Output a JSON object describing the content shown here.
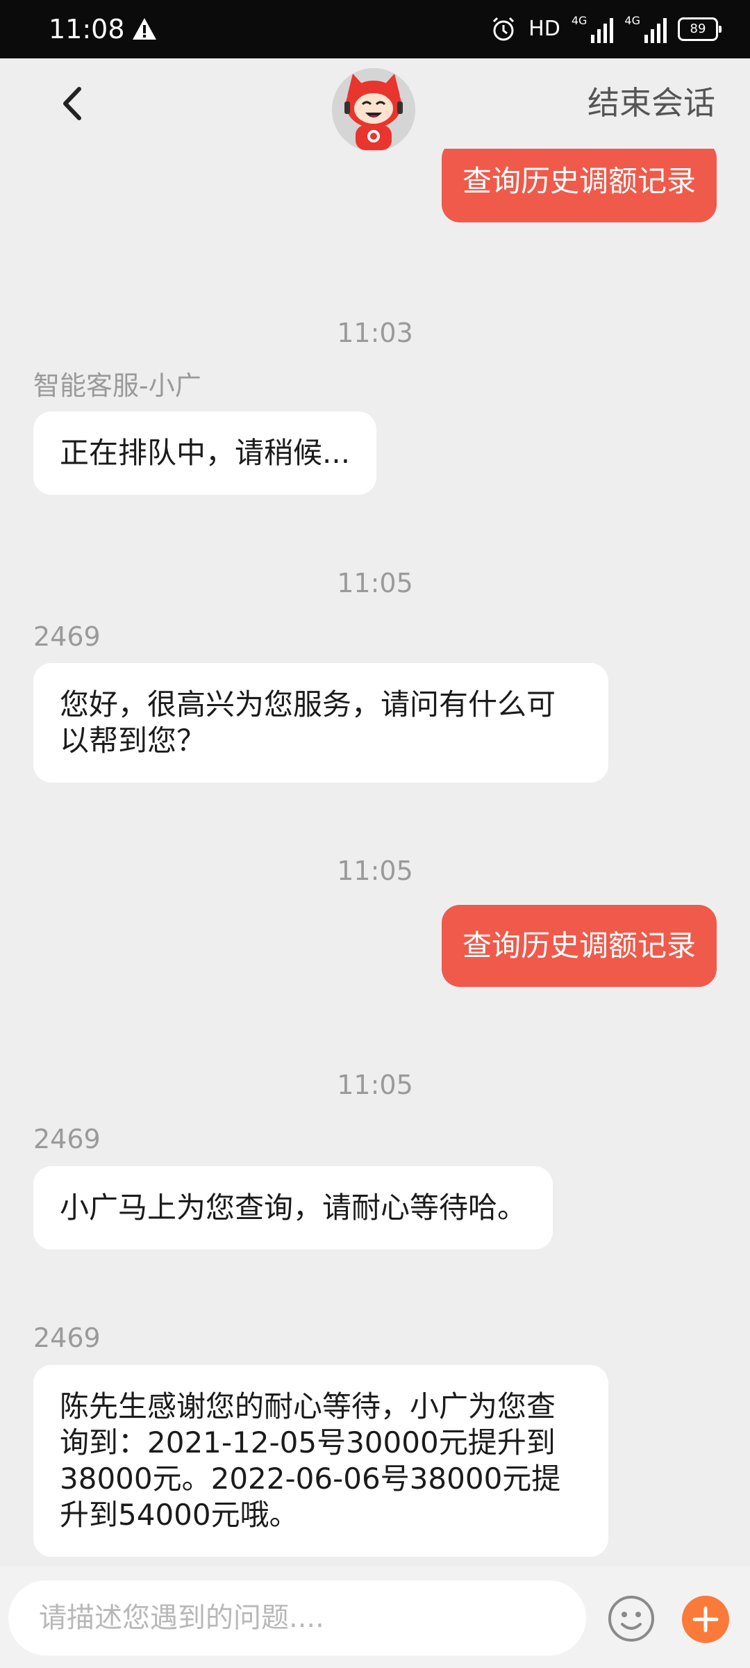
{
  "status_bar": {
    "time": "11:08",
    "hd_label": "HD",
    "net1_label": "4G",
    "net2_label": "4G",
    "battery": "89"
  },
  "header": {
    "back_icon": "chevron-left-icon",
    "avatar_icon": "robot-mascot-avatar",
    "end_session": "结束会话"
  },
  "messages": [
    {
      "type": "user",
      "text": "查询历史调额记录"
    },
    {
      "type": "time",
      "text": "11:03"
    },
    {
      "type": "sender",
      "text": "智能客服-小广"
    },
    {
      "type": "agent",
      "text": "正在排队中，请稍候..."
    },
    {
      "type": "time",
      "text": "11:05"
    },
    {
      "type": "sender",
      "text": "2469"
    },
    {
      "type": "agent",
      "text": "您好，很高兴为您服务，请问有什么可以帮到您？"
    },
    {
      "type": "time",
      "text": "11:05"
    },
    {
      "type": "user",
      "text": "查询历史调额记录"
    },
    {
      "type": "time",
      "text": "11:05"
    },
    {
      "type": "sender",
      "text": "2469"
    },
    {
      "type": "agent",
      "text": "小广马上为您查询，请耐心等待哈。"
    },
    {
      "type": "sender",
      "text": "2469"
    },
    {
      "type": "agent",
      "text": "陈先生感谢您的耐心等待，小广为您查询到：2021-12-05号30000元提升到38000元。2022-06-06号38000元提升到54000元哦。"
    }
  ],
  "input_bar": {
    "placeholder": "请描述您遇到的问题....",
    "emoji_icon": "smiley-icon",
    "plus_icon": "plus-icon"
  },
  "colors": {
    "accent": "#ef5a4a",
    "plus_button": "#fa7a3a",
    "background": "#eeeeee"
  }
}
